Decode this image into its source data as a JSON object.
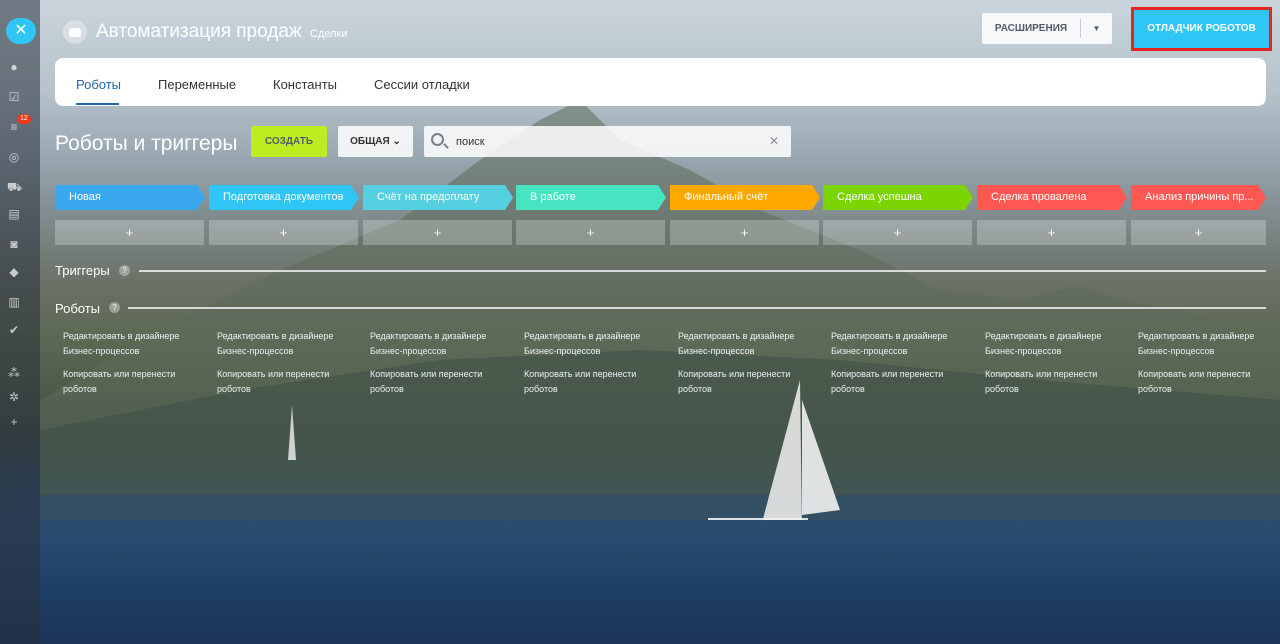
{
  "header": {
    "title": "Автоматизация продаж",
    "subtitle": "Сделки",
    "extensions_label": "РАСШИРЕНИЯ",
    "debugger_label": "ОТЛАДЧИК РОБОТОВ"
  },
  "sidebar": {
    "counter_badge": "12"
  },
  "tabs": [
    {
      "label": "Роботы",
      "active": true
    },
    {
      "label": "Переменные",
      "active": false
    },
    {
      "label": "Константы",
      "active": false
    },
    {
      "label": "Сессии отладки",
      "active": false
    }
  ],
  "toolbar": {
    "section_title": "Роботы и триггеры",
    "create_label": "СОЗДАТЬ",
    "filter_label": "ОБЩАЯ",
    "search_placeholder": "поиск"
  },
  "stages": [
    {
      "label": "Новая",
      "color": "#39a8ef"
    },
    {
      "label": "Подготовка документов",
      "color": "#2fc6f6"
    },
    {
      "label": "Счёт на предоплату",
      "color": "#55d0e0"
    },
    {
      "label": "В работе",
      "color": "#47e4c2"
    },
    {
      "label": "Финальный счёт",
      "color": "#ffa900"
    },
    {
      "label": "Сделка успешна",
      "color": "#7bd500"
    },
    {
      "label": "Сделка провалена",
      "color": "#ff5752"
    },
    {
      "label": "Анализ причины пр...",
      "color": "#ff5752"
    }
  ],
  "add_symbol": "+",
  "triggers_label": "Триггеры",
  "robots_label": "Роботы",
  "column_links": {
    "edit": "Редактировать в дизайнере Бизнес-процессов",
    "copy": "Копировать или перенести роботов"
  }
}
